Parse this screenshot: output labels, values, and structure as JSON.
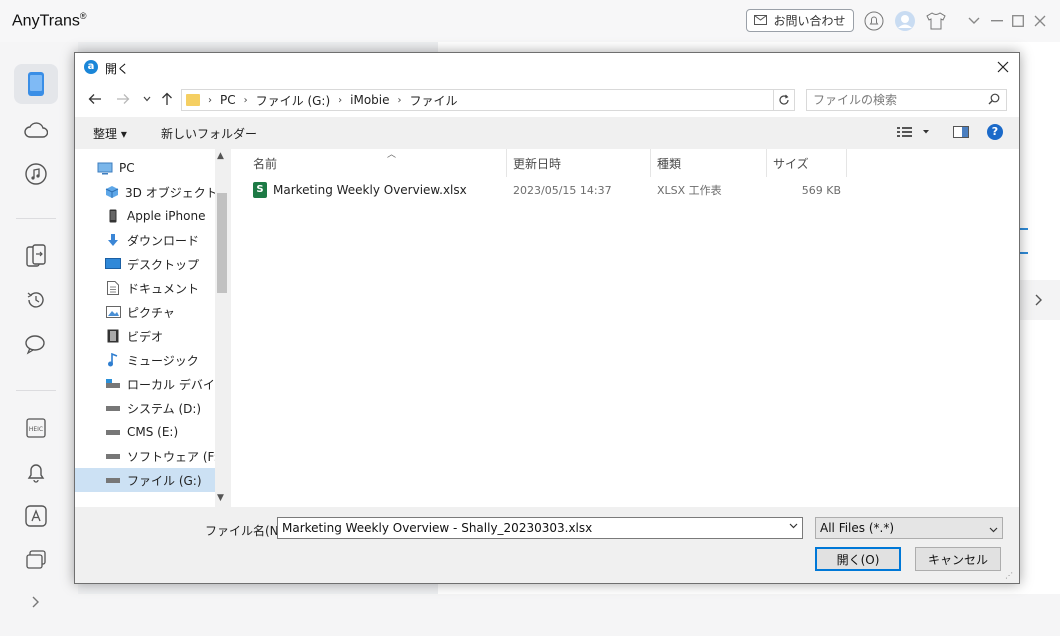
{
  "app": {
    "title": "AnyTrans",
    "trademark": "®",
    "contact_label": "お問い合わせ"
  },
  "dialog": {
    "title": "開く",
    "icon_letter": "a",
    "breadcrumb": [
      "PC",
      "ファイル (G:)",
      "iMobie",
      "ファイル"
    ],
    "search_placeholder": "ファイルの検索",
    "toolbar": {
      "organize_label": "整理 ▾",
      "new_folder_label": "新しいフォルダー"
    },
    "nav_items": [
      {
        "label": "PC",
        "icon": "pc-icon"
      },
      {
        "label": "3D オブジェクト",
        "icon": "3d-objects-icon"
      },
      {
        "label": "Apple iPhone",
        "icon": "phone-icon"
      },
      {
        "label": "ダウンロード",
        "icon": "download-icon"
      },
      {
        "label": "デスクトップ",
        "icon": "desktop-icon"
      },
      {
        "label": "ドキュメント",
        "icon": "document-icon"
      },
      {
        "label": "ピクチャ",
        "icon": "picture-icon"
      },
      {
        "label": "ビデオ",
        "icon": "video-icon"
      },
      {
        "label": "ミュージック",
        "icon": "music-icon"
      },
      {
        "label": "ローカル デバイス (C",
        "icon": "drive-icon"
      },
      {
        "label": "システム (D:)",
        "icon": "drive-icon"
      },
      {
        "label": "CMS (E:)",
        "icon": "drive-icon"
      },
      {
        "label": "ソフトウェア (F:)",
        "icon": "drive-icon"
      },
      {
        "label": "ファイル (G:)",
        "icon": "drive-icon",
        "selected": true
      }
    ],
    "columns": {
      "name": "名前",
      "date": "更新日時",
      "type": "種類",
      "size": "サイズ"
    },
    "files": [
      {
        "name": "Marketing Weekly Overview.xlsx",
        "date": "2023/05/15 14:37",
        "type": "XLSX 工作表",
        "size": "569 KB"
      }
    ],
    "filename_label": "ファイル名(N):",
    "filename_value": "Marketing Weekly Overview - Shally_20230303.xlsx",
    "filter_value": "All Files (*.*)",
    "open_label": "開く(O)",
    "cancel_label": "キャンセル"
  },
  "colors": {
    "accent": "#0078d7",
    "selection": "#cce1f4",
    "xlsx_green": "#1d7a45"
  }
}
